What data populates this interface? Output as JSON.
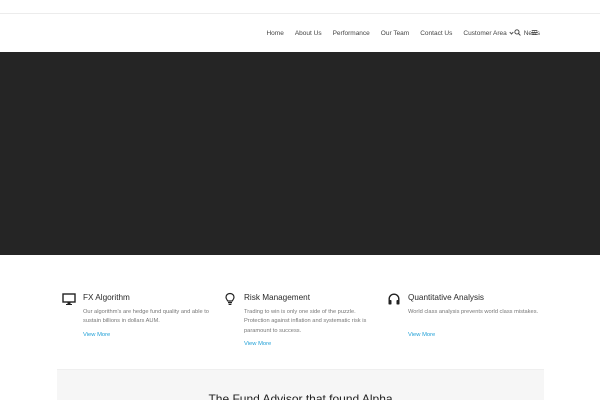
{
  "nav": {
    "items": [
      {
        "label": "Home"
      },
      {
        "label": "About Us"
      },
      {
        "label": "Performance"
      },
      {
        "label": "Our Team"
      },
      {
        "label": "Contact Us"
      },
      {
        "label": "Customer Area"
      },
      {
        "label": "News"
      }
    ]
  },
  "icons": {
    "search": "search-icon",
    "menu": "hamburger-menu-icon",
    "feature1": "desktop-monitor-icon",
    "feature2": "lightbulb-icon",
    "feature3": "headphones-icon"
  },
  "colors": {
    "hero_background": "#252525",
    "link": "#1e9fd6",
    "band_background": "#f6f6f6"
  },
  "features": [
    {
      "title": "FX Algorithm",
      "description": "Our algorithm's are hedge fund quality and able to sustain billions in dollars AUM.",
      "link": "View More"
    },
    {
      "title": "Risk Management",
      "description": "Trading to win is only one side of the puzzle. Protection against inflation and systematic risk is paramount to success.",
      "link": "View More"
    },
    {
      "title": "Quantitative Analysis",
      "description": "World class analysis prevents world class mistakes.",
      "link": "View More"
    }
  ],
  "band": {
    "title": "The Fund Advisor that found Alpha"
  }
}
